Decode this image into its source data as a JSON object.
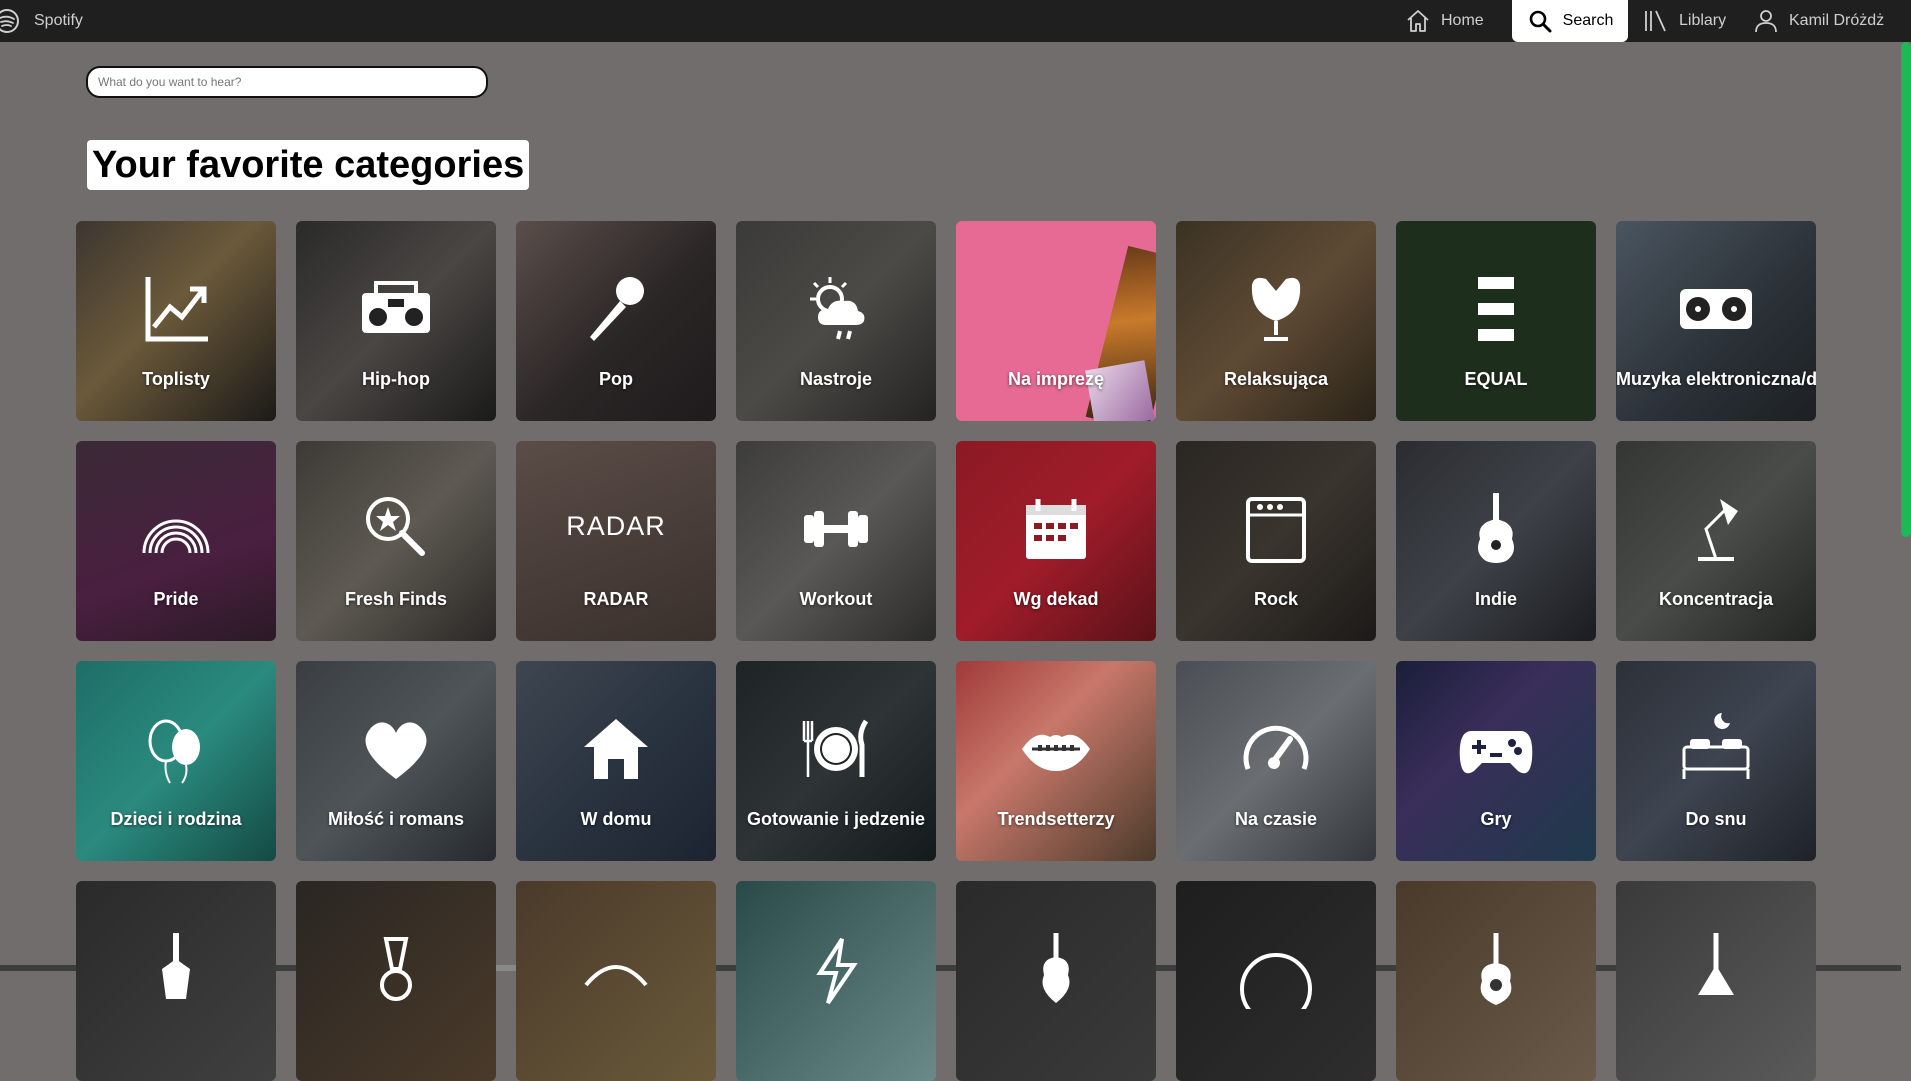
{
  "topbar": {
    "brand": "Spotify",
    "home_label": "Home",
    "search_label": "Search",
    "library_label": "Liblary",
    "user_name": "Kamil Dróżdż"
  },
  "search": {
    "placeholder": "What do you want to hear?"
  },
  "section": {
    "title": "Your favorite categories"
  },
  "accent_color": "#1db954",
  "categories": [
    {
      "label": "Toplisty",
      "icon": "chart-up-icon"
    },
    {
      "label": "Hip-hop",
      "icon": "boombox-icon"
    },
    {
      "label": "Pop",
      "icon": "microphone-icon"
    },
    {
      "label": "Nastroje",
      "icon": "weather-icon"
    },
    {
      "label": "Na imprezę",
      "icon": "album-art"
    },
    {
      "label": "Relaksująca",
      "icon": "egg-chair-icon"
    },
    {
      "label": "EQUAL",
      "icon": "equal-bars-icon"
    },
    {
      "label": "Muzyka elektroniczna/d",
      "icon": "turntable-icon"
    },
    {
      "label": "Pride",
      "icon": "rainbow-icon"
    },
    {
      "label": "Fresh Finds",
      "icon": "magnifier-star-icon"
    },
    {
      "label": "RADAR",
      "icon": "radar-text",
      "text": "RADAR"
    },
    {
      "label": "Workout",
      "icon": "dumbbell-icon"
    },
    {
      "label": "Wg dekad",
      "icon": "calendar-icon"
    },
    {
      "label": "Rock",
      "icon": "amplifier-icon"
    },
    {
      "label": "Indie",
      "icon": "guitar-icon"
    },
    {
      "label": "Koncentracja",
      "icon": "desk-lamp-icon"
    },
    {
      "label": "Dzieci i rodzina",
      "icon": "balloons-icon"
    },
    {
      "label": "Miłość i romans",
      "icon": "heart-icon"
    },
    {
      "label": "W domu",
      "icon": "house-icon"
    },
    {
      "label": "Gotowanie i jedzenie",
      "icon": "plate-cutlery-icon"
    },
    {
      "label": "Trendsetterzy",
      "icon": "lips-icon"
    },
    {
      "label": "Na czasie",
      "icon": "speedometer-icon"
    },
    {
      "label": "Gry",
      "icon": "gamepad-icon"
    },
    {
      "label": "Do snu",
      "icon": "bed-icon"
    },
    {
      "label": "",
      "icon": "electric-guitar-icon"
    },
    {
      "label": "",
      "icon": "trumpet-icon"
    },
    {
      "label": "",
      "icon": "mask-icon"
    },
    {
      "label": "",
      "icon": "lightning-icon"
    },
    {
      "label": "",
      "icon": "violin-icon"
    },
    {
      "label": "",
      "icon": "vinyl-icon"
    },
    {
      "label": "",
      "icon": "acoustic-guitar-icon"
    },
    {
      "label": "",
      "icon": "mandolin-icon"
    }
  ]
}
